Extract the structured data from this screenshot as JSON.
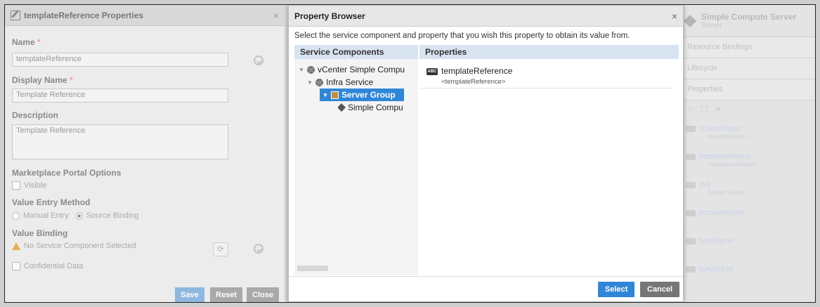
{
  "left_panel": {
    "title": "templateReference Properties",
    "close": "×",
    "name_label": "Name",
    "name_value": "templateReference",
    "display_name_label": "Display Name",
    "display_name_value": "Template Reference",
    "description_label": "Description",
    "description_value": "Template Reference",
    "marketplace_label": "Marketplace Portal Options",
    "visible_label": "Visible",
    "entry_method_label": "Value Entry Method",
    "manual_entry": "Manual Entry",
    "source_binding": "Source Binding",
    "value_binding_label": "Value Binding",
    "no_component": "No Service Component Selected",
    "confidential_label": "Confidential Data",
    "required_mark": "*",
    "buttons": {
      "save": "Save",
      "reset": "Reset",
      "close": "Close"
    }
  },
  "modal": {
    "title": "Property Browser",
    "close": "×",
    "instruction": "Select the service component and property that you wish this property to obtain its value from.",
    "components_header": "Service Components",
    "properties_header": "Properties",
    "tree": [
      {
        "label": "vCenter Simple Compu",
        "level": 0
      },
      {
        "label": "Infra Service",
        "level": 1
      },
      {
        "label": "Server Group",
        "level": 2,
        "selected": true
      },
      {
        "label": "Simple Compu",
        "level": 3
      }
    ],
    "property": {
      "name": "templateReference",
      "token": "<templateReference>",
      "badge": "ABC"
    },
    "buttons": {
      "select": "Select",
      "cancel": "Cancel"
    }
  },
  "right_panel": {
    "title": "Simple Compute Server",
    "subtitle": "Server",
    "sections": [
      "Resource Bindings",
      "Lifecycle",
      "Properties"
    ],
    "props": [
      {
        "name": "customSpec",
        "token": "<customSpec>"
      },
      {
        "name": "datastoreName",
        "token": "<datastoreName>"
      },
      {
        "name": "dvs",
        "token": "Server Group"
      },
      {
        "name": "domainName",
        "token": ""
      },
      {
        "name": "hostName",
        "token": ""
      },
      {
        "name": "ipAddress",
        "token": ""
      }
    ]
  },
  "colors": {
    "primary": "#2f86d8",
    "secondary": "#767676",
    "selected_row": "#2f86d8",
    "header_blue": "#d7e3ef"
  }
}
